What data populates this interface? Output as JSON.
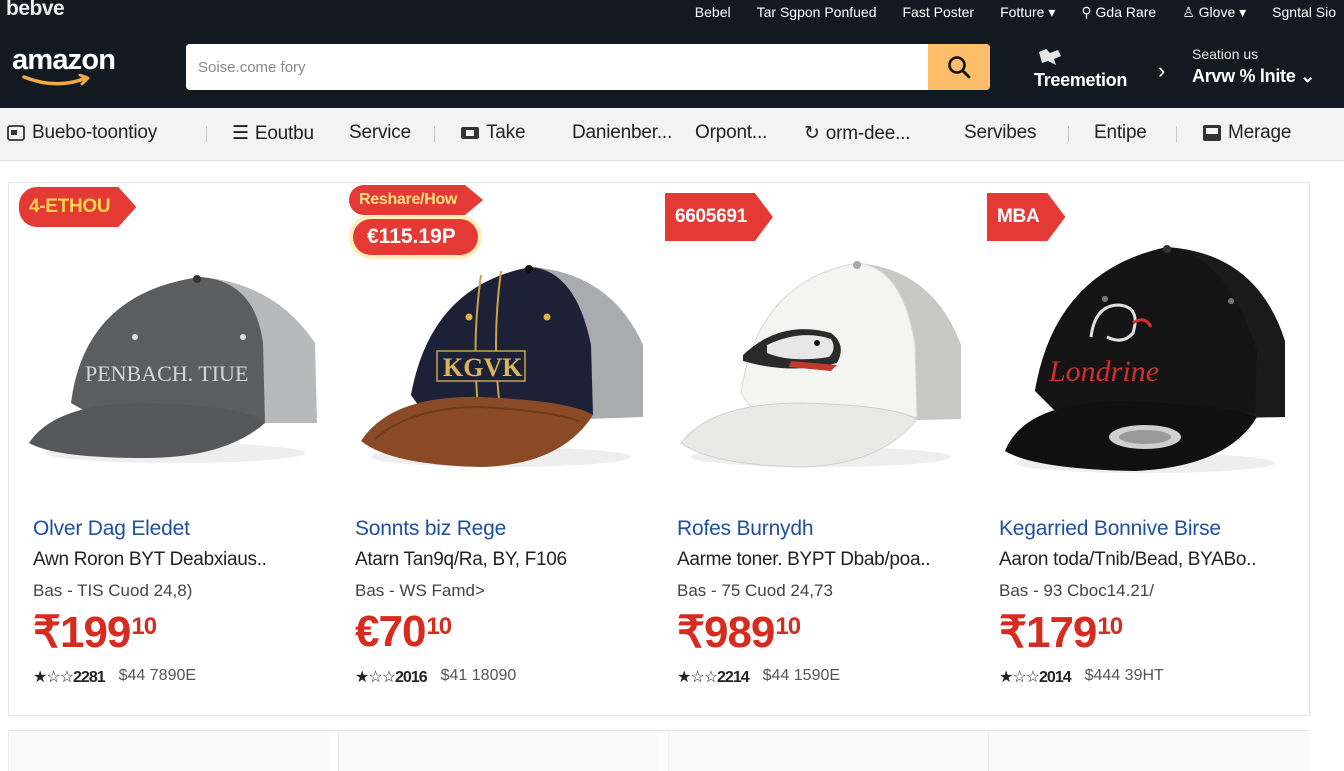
{
  "util": {
    "brand": "bebve",
    "links": [
      "Bebel",
      "Tar Sgpon Ponfued",
      "Fast Poster",
      "Fotture",
      "Gda Rare",
      "Glove",
      "Sgntal Sio"
    ]
  },
  "header": {
    "logo": "amazon",
    "search_placeholder": "Soise.come fory",
    "deliver_label": "Treemetion",
    "account_line1": "Seation us",
    "account_line2": "Arvw  % lnite"
  },
  "subnav": {
    "items": [
      "Buebo-toontioy",
      "Eoutbu",
      "Service",
      "Take",
      "Danienber...",
      "Orpont...",
      "orm-dee...",
      "Servibes",
      "Entipe",
      "Merage"
    ]
  },
  "products": [
    {
      "badge": "4-ETHOU",
      "title": "Olver Dag Eledet",
      "subtitle": "Awn Roron BYT Deabxiaus..",
      "meta": "Bas - TIS Cuod 24,8)",
      "price": "₹199",
      "price_fraction": "10",
      "stars": "★☆☆",
      "rating_count": "2281",
      "reviews": "$44 7890E",
      "cap_text": "PENBACH. TIUE",
      "colors": {
        "crown": "#5b5d5f",
        "brim": "#55575a",
        "mesh": "#b7b9bb"
      }
    },
    {
      "badge": "Reshare/How",
      "badge2": "€115.19P",
      "title": "Sonnts biz Rege",
      "subtitle": "Atarn Tan9q/Ra, BY, F106",
      "meta": "Bas - WS Famd>",
      "price": "€70",
      "price_fraction": "10",
      "stars": "★☆☆",
      "rating_count": "2016",
      "reviews": "$41 18090",
      "cap_text": "KGVK",
      "colors": {
        "crown": "#1d2138",
        "brim": "#8a4a26",
        "mesh": "#a9abae"
      }
    },
    {
      "badge": "6605691",
      "title": "Rofes Burnydh",
      "subtitle": "Aarme toner. BYPT Dbab/poa..",
      "meta": "Bas - 75 Cuod 24,73",
      "price": "₹989",
      "price_fraction": "10",
      "stars": "★☆☆",
      "rating_count": "2214",
      "reviews": "$44 1590E",
      "cap_text": "",
      "colors": {
        "crown": "#f4f4f2",
        "brim": "#e9e9e7",
        "mesh": "#c8c8c6"
      }
    },
    {
      "badge": "MBA",
      "title": "Kegarried Bonnive Birse",
      "subtitle": "Aaron toda/Tnib/Bead, BYABo..",
      "meta": "Bas - 93 Cboc14.21/",
      "price": "₹179",
      "price_fraction": "10",
      "stars": "★☆☆",
      "rating_count": "2014",
      "reviews": "$444 39HT",
      "cap_text": "Londrine",
      "colors": {
        "crown": "#141414",
        "brim": "#101010",
        "mesh": "#1a1a1a"
      }
    }
  ]
}
